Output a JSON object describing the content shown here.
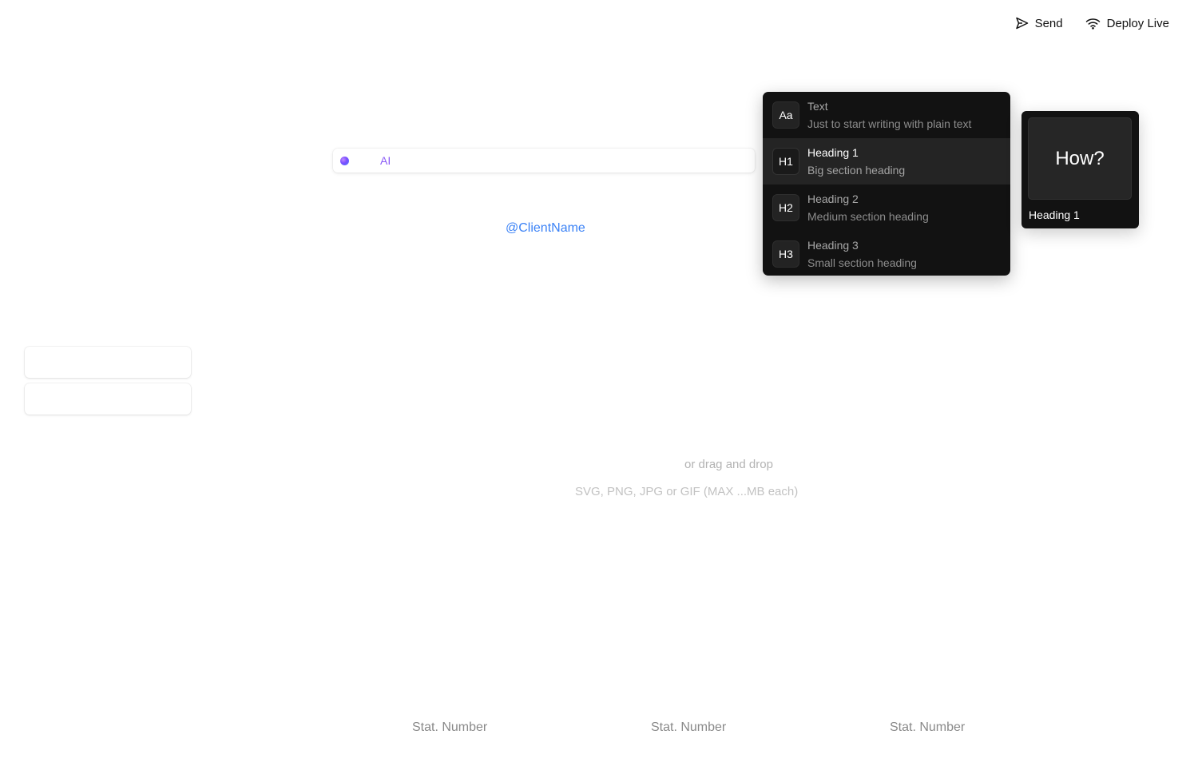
{
  "header": {
    "send_label": "Send",
    "deploy_label": "Deploy Live"
  },
  "ai_bar": {
    "label": "AI"
  },
  "mention": {
    "text": "@ClientName",
    "color": "#3b82f6"
  },
  "block_menu": {
    "items": [
      {
        "badge": "Aa",
        "title": "Text",
        "description": "Just to start writing with plain text",
        "active": false
      },
      {
        "badge": "H1",
        "title": "Heading 1",
        "description": "Big section heading",
        "active": true
      },
      {
        "badge": "H2",
        "title": "Heading 2",
        "description": "Medium section heading",
        "active": false
      },
      {
        "badge": "H3",
        "title": "Heading 3",
        "description": "Small section heading",
        "active": false
      }
    ]
  },
  "preview": {
    "sample": "How?",
    "label": "Heading 1"
  },
  "upload": {
    "drag_text": "or drag and drop",
    "formats_text": "SVG, PNG, JPG or GIF (MAX ...MB each)"
  },
  "stats": [
    {
      "label": "Stat. Number"
    },
    {
      "label": "Stat. Number"
    },
    {
      "label": "Stat. Number"
    }
  ]
}
